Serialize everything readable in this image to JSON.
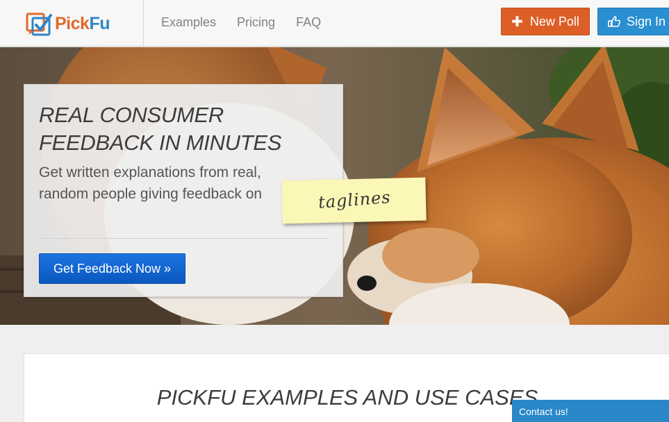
{
  "brand": {
    "name_pick": "Pick",
    "name_fu": "Fu"
  },
  "nav": {
    "items": [
      "Examples",
      "Pricing",
      "FAQ"
    ]
  },
  "header_buttons": {
    "new_poll": "New Poll",
    "sign_in": "Sign In"
  },
  "hero": {
    "title": "REAL CONSUMER FEEDBACK IN MINUTES",
    "subtitle": "Get written explanations from real, random people giving feedback on",
    "sticky_note": "taglines",
    "cta": "Get Feedback Now »"
  },
  "examples": {
    "title": "PICKFU EXAMPLES AND USE CASES"
  },
  "contact": {
    "label": "Contact us!"
  },
  "colors": {
    "orange": "#dd5f27",
    "blue": "#2a8fd0",
    "cta_blue": "#0a57c0"
  }
}
